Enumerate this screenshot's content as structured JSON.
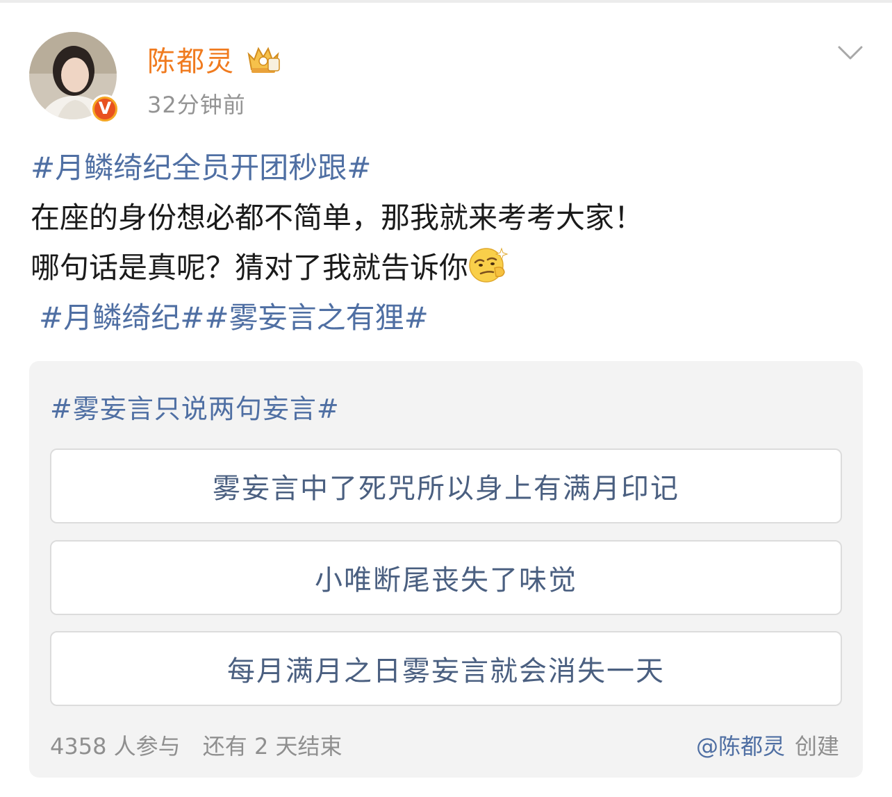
{
  "post": {
    "username": "陈都灵",
    "time": "32分钟前",
    "lines": {
      "hashtag_main": "#月鳞绮纪全员开团秒跟#",
      "text1": "在座的身份想必都不简单，那我就来考考大家！",
      "text2": "哪句话是真呢？猜对了我就告诉你",
      "topic1": "#月鳞绮纪#",
      "topic2": "#雾妄言之有狸#"
    },
    "icons": {
      "avatar": "avatar-photo",
      "verified": "verified-v-badge",
      "crown": "crown-member-icon",
      "menu": "chevron-down-icon",
      "emoji": "smirk-emoji-icon"
    },
    "verified_letter": "V",
    "colors": {
      "username": "#f07b1f",
      "link": "#4f6fa3",
      "muted": "#939393",
      "badge": "#f5a623"
    }
  },
  "poll": {
    "title": "#雾妄言只说两句妄言#",
    "options": [
      {
        "label": "雾妄言中了死咒所以身上有满月印记"
      },
      {
        "label": "小唯断尾丧失了味觉"
      },
      {
        "label": "每月满月之日雾妄言就会消失一天"
      }
    ],
    "participants": "4358 人参与",
    "remaining": "还有 2 天结束",
    "creator": "@陈都灵",
    "created_label": "创建"
  }
}
